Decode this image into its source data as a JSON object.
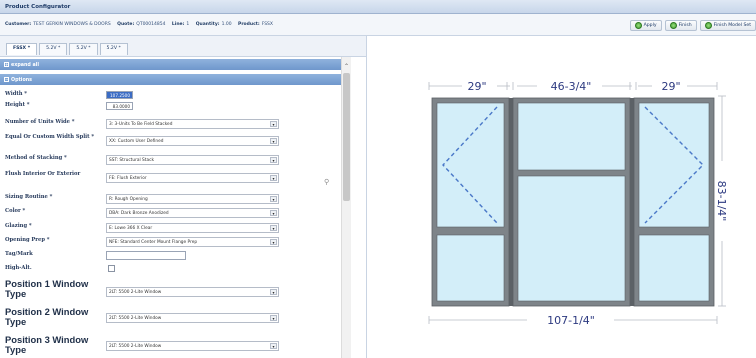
{
  "window": {
    "title": "Product Configurator"
  },
  "info": {
    "customer_label": "Customer:",
    "customer_value": "TEST GERKIN WINDOWS & DOORS",
    "quote_label": "Quote:",
    "quote_value": "QT00014854",
    "line_label": "Line:",
    "line_value": "1",
    "quantity_label": "Quantity:",
    "quantity_value": "1.00",
    "product_label": "Product:",
    "product_value": "FSSX"
  },
  "actions": {
    "apply": "Apply",
    "finish": "Finish",
    "finish_model": "Finish Model Set"
  },
  "tabs": [
    "FSSX *",
    "5.2V *",
    "5.2V *",
    "5.2V *"
  ],
  "panel": {
    "expand_all": "expand all",
    "options": "Options"
  },
  "fields": {
    "width": {
      "label": "Width *",
      "value": "107.2500"
    },
    "height": {
      "label": "Height *",
      "value": "83.0000"
    },
    "units_wide": {
      "label": "Number of Units Wide *",
      "value": "3: 3-Units To Be Field Stacked"
    },
    "width_split": {
      "label": "Equal Or Custom Width Split *",
      "value": "XX: Custom User Defined"
    },
    "stacking": {
      "label": "Method of Stacking *",
      "value": "SST: Structural Stack"
    },
    "flush": {
      "label": "Flush Interior Or Exterior",
      "value": "FE: Flush Exterior"
    },
    "sizing": {
      "label": "Sizing Routine *",
      "value": "R: Rough Opening"
    },
    "color": {
      "label": "Color *",
      "value": "DBA: Dark Bronze Anodized"
    },
    "glazing": {
      "label": "Glazing *",
      "value": "E: Lowe 366 X Clear"
    },
    "opening_prep": {
      "label": "Opening Prep *",
      "value": "NFE: Standard Center Mount Flange Prep"
    },
    "tag_mark": {
      "label": "Tag/Mark",
      "value": ""
    },
    "high_alt": {
      "label": "High-Alt."
    },
    "pos1": {
      "label": "Position 1 Window Type",
      "value": "2LT: 5500 2-Lite Window"
    },
    "pos2": {
      "label": "Position 2 Window Type",
      "value": "2LT: 5500 2-Lite Window"
    },
    "pos3": {
      "label": "Position 3 Window Type",
      "value": "2LT: 5500 2-Lite Window"
    }
  },
  "drawing": {
    "dim_left": "29\"",
    "dim_center": "46-3/4\"",
    "dim_right": "29\"",
    "dim_height": "83-1/4\"",
    "dim_width": "107-1/4\"",
    "glass_color": "#d3eef9",
    "frame_color": "#7e8489",
    "dim_color": "#2d3a80"
  }
}
